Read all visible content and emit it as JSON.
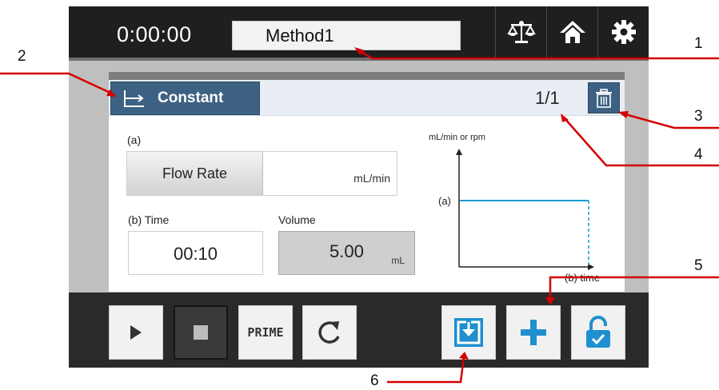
{
  "topbar": {
    "timer": "0:00:00",
    "method_name": "Method1",
    "buttons": [
      "scale-icon",
      "home-icon",
      "gear-icon"
    ]
  },
  "panel": {
    "mode_label": "Constant",
    "page_count": "1/1",
    "flow_label": "(a)",
    "flow_button": "Flow Rate",
    "flow_unit": "mL/min",
    "time_label": "(b) Time",
    "time_value": "00:10",
    "volume_label": "Volume",
    "volume_value": "5.00",
    "volume_unit": "mL"
  },
  "graph": {
    "y_label": "mL/min or rpm",
    "a_label": "(a)",
    "x_label": "(b) time",
    "line_color": "#1a9ad6"
  },
  "bottombar": {
    "prime_label": "PRIME",
    "accent_color": "#1e8fcf"
  },
  "callouts": {
    "n1": "1",
    "n2": "2",
    "n3": "3",
    "n4": "4",
    "n5": "5",
    "n6": "6",
    "color": "#d40000"
  }
}
